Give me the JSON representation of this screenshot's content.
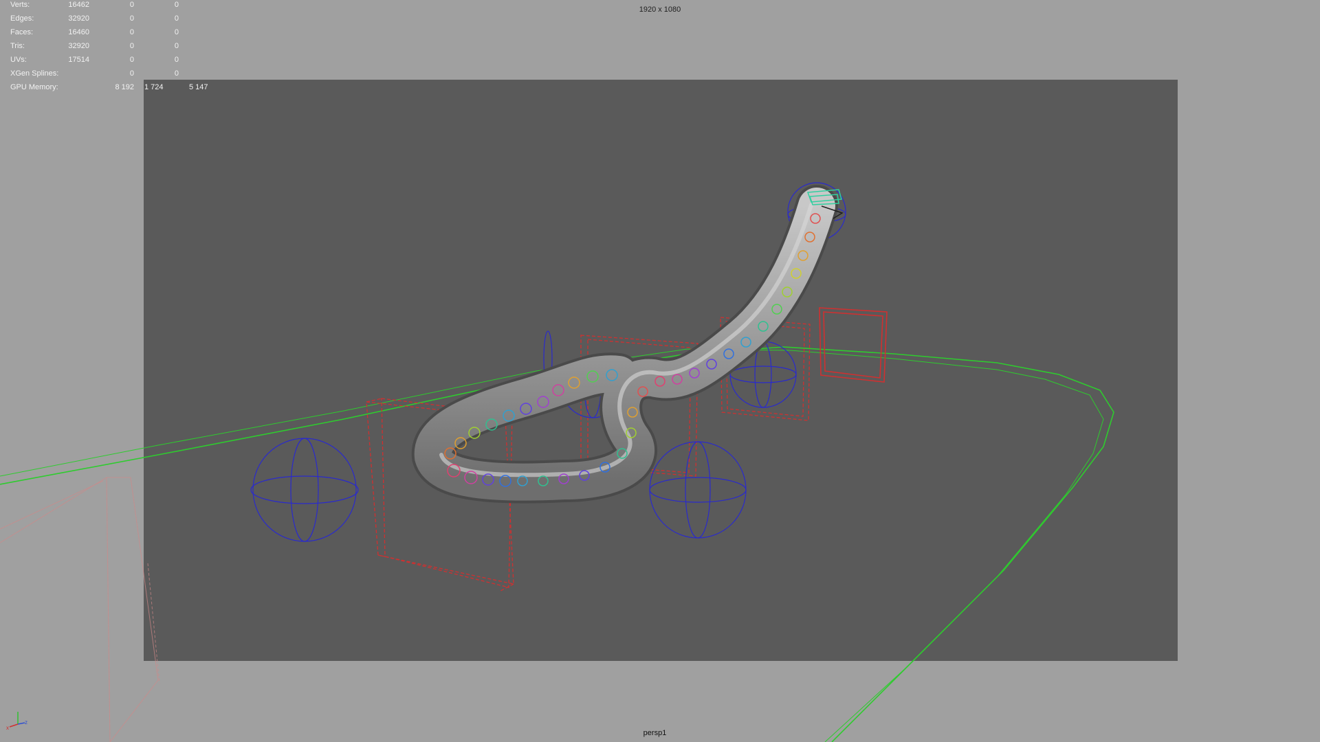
{
  "window": {
    "resolution_label": "1920 x 1080",
    "camera_name": "persp1"
  },
  "hud": {
    "rows": [
      {
        "label": "Verts:",
        "values": [
          "16462",
          "0",
          "0"
        ]
      },
      {
        "label": "Edges:",
        "values": [
          "32920",
          "0",
          "0"
        ]
      },
      {
        "label": "Faces:",
        "values": [
          "16460",
          "0",
          "0"
        ]
      },
      {
        "label": "Tris:",
        "values": [
          "32920",
          "0",
          "0"
        ]
      },
      {
        "label": "UVs:",
        "values": [
          "17514",
          "0",
          "0"
        ]
      },
      {
        "label": "XGen Splines:",
        "values": [
          "0",
          "0"
        ]
      },
      {
        "label": "GPU Memory:",
        "values": [
          "8 192",
          "1 724",
          "5 147"
        ]
      }
    ]
  },
  "axis_gizmo": {
    "x_label": "x",
    "z_label": "z"
  },
  "colors": {
    "viewport_bg": "#a0a0a0",
    "render_gate": "#5a5a5a",
    "curve": "#2ecc2e",
    "box_control": "#d03030",
    "sphere_control": "#2a2acc"
  }
}
